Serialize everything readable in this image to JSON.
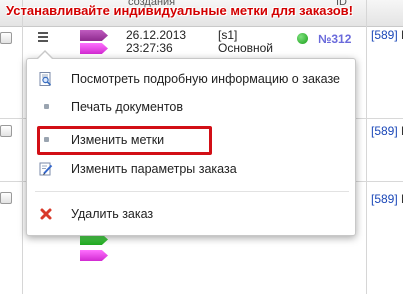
{
  "banner": {
    "text": "Устанавливайте индивидуальные метки для заказов!",
    "color": "#d20000"
  },
  "table": {
    "header": {
      "date_col": "создания",
      "extra_col": "ID"
    },
    "rows": [
      {
        "date": "26.12.2013",
        "time": "23:27:36",
        "site": "[s1]",
        "site_name": "Основной",
        "order_no": "№312",
        "user_id": "[589]",
        "user_suffix": "Ю"
      },
      {
        "user_id": "[589]",
        "user_suffix": "Ю"
      },
      {
        "user_id": "[589]",
        "user_suffix": "Ю"
      }
    ]
  },
  "context_menu": {
    "items": [
      {
        "label": "Посмотреть подробную информацию о заказе",
        "icon": "magnifier-document-icon"
      },
      {
        "label": "Печать документов",
        "icon": "bullet-icon"
      },
      {
        "label": "Изменить метки",
        "icon": "bullet-icon"
      },
      {
        "label": "Изменить параметры заказа",
        "icon": "edit-document-icon"
      },
      {
        "label": "Удалить заказ",
        "icon": "red-x-icon"
      }
    ],
    "highlighted_item": "Изменить метки",
    "highlight_color": "#d20f16"
  },
  "colors": {
    "tag_purple": "#a040a0",
    "tag_green": "#2ec72e",
    "tag_magenta": "#ee40ee",
    "status_green": "#22aa22",
    "order_link": "#6a6adb"
  }
}
